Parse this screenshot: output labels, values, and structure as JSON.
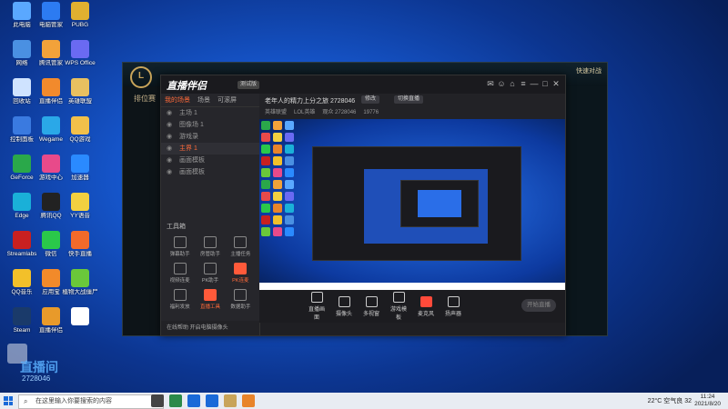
{
  "desktop_icons": [
    {
      "label": "此电脑",
      "color": "#5aa8ff"
    },
    {
      "label": "电脑管家",
      "color": "#2c7bf2"
    },
    {
      "label": "PUBG",
      "color": "#e0b030"
    },
    {
      "label": "网络",
      "color": "#4a90e2"
    },
    {
      "label": "腾讯管家",
      "color": "#f2a23a"
    },
    {
      "label": "WPS Office",
      "color": "#6a6af2"
    },
    {
      "label": "回收站",
      "color": "#cfe3ff"
    },
    {
      "label": "直播伴侣",
      "color": "#f28a2c"
    },
    {
      "label": "英雄联盟",
      "color": "#e8c060"
    },
    {
      "label": "控制面板",
      "color": "#3a7ae0"
    },
    {
      "label": "Wegame",
      "color": "#2aa8e8"
    },
    {
      "label": "QQ游戏",
      "color": "#f2c04a"
    },
    {
      "label": "GeForce",
      "color": "#2aa84a"
    },
    {
      "label": "游戏中心",
      "color": "#e84a8a"
    },
    {
      "label": "加速器",
      "color": "#2a8aff"
    },
    {
      "label": "Edge",
      "color": "#1ab0d8"
    },
    {
      "label": "腾讯QQ",
      "color": "#222"
    },
    {
      "label": "YY语音",
      "color": "#f2d040"
    },
    {
      "label": "Streamlabs",
      "color": "#c82020"
    },
    {
      "label": "微信",
      "color": "#2ac84a"
    },
    {
      "label": "快手直播",
      "color": "#f26a2a"
    },
    {
      "label": "QQ音乐",
      "color": "#f2c02a"
    },
    {
      "label": "应用宝",
      "color": "#f28a2a"
    },
    {
      "label": "植物大战僵尸",
      "color": "#6ac83a"
    },
    {
      "label": "Steam",
      "color": "#1a3a6a"
    },
    {
      "label": "直播伴侣",
      "color": "#e89a2a"
    },
    {
      "label": "",
      "color": "#ffffff"
    }
  ],
  "stream_overlay": {
    "number": "直播间",
    "id": "2728046"
  },
  "background_window": {
    "logo": "L",
    "nav": "排位赛",
    "right_text": "快速对战"
  },
  "app": {
    "brand": "直播伴侣",
    "badge": "测试版",
    "title_buttons": [
      "✉",
      "☺",
      "⌂",
      "≡",
      "—",
      "□",
      "✕"
    ],
    "left_tabs": [
      "我的场景",
      "场景",
      "可滚屏"
    ],
    "scenes": [
      {
        "label": "主场 1",
        "active": false
      },
      {
        "label": "图像场 1",
        "active": false
      },
      {
        "label": "游戏录",
        "active": false
      },
      {
        "label": "主界 1",
        "active": true
      },
      {
        "label": "画面模板",
        "active": false
      },
      {
        "label": "画面模板",
        "active": false
      }
    ],
    "tools_title": "工具箱",
    "tools": [
      {
        "label": "弹幕助手",
        "hot": false
      },
      {
        "label": "房管助手",
        "hot": false
      },
      {
        "label": "主播任务",
        "hot": false
      },
      {
        "label": "视频连麦",
        "hot": false
      },
      {
        "label": "PK助手",
        "hot": false
      },
      {
        "label": "PK连麦",
        "hot": true
      },
      {
        "label": "福利发放",
        "hot": false
      },
      {
        "label": "直播工具",
        "hot": true
      },
      {
        "label": "数据助手",
        "hot": false
      }
    ],
    "bottom_tip": "在线帮助 开启电脑摄像头",
    "room": {
      "name": "老年人的精力上分之旅 2728046",
      "pill1": "修改",
      "pill2": "切换直播",
      "sub": [
        "英雄联盟",
        "LOL英雄",
        "观众 2728046",
        "19776"
      ]
    },
    "controls": [
      {
        "label": "直播画面",
        "red": false
      },
      {
        "label": "摄像头",
        "red": false
      },
      {
        "label": "多视窗",
        "red": false
      },
      {
        "label": "游戏模板",
        "red": false
      },
      {
        "label": "麦克风",
        "red": true
      },
      {
        "label": "扬声器",
        "red": false
      }
    ],
    "go_live": "开始直播"
  },
  "taskbar": {
    "search_placeholder": "在这里输入你要搜索的内容",
    "tray": "22°C 空气良 32",
    "time": "11:24",
    "date": "2021/8/20",
    "app_colors": [
      "#444",
      "#2a8a4a",
      "#1a6ad8",
      "#1a6ad8",
      "#c8a45a",
      "#e8842a"
    ]
  }
}
